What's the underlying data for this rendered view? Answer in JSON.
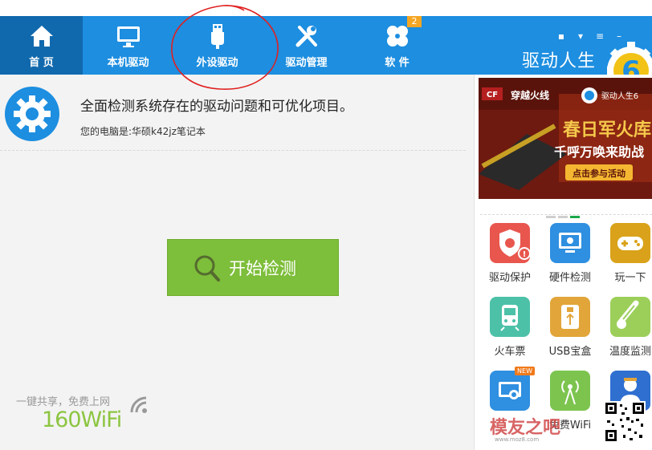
{
  "colors": {
    "nav_bg": "#1d8ee0",
    "nav_active_bg": "#1169ad",
    "start_button": "#7dbe3a",
    "badge": "#f5a623",
    "annotation_circle": "#e02020"
  },
  "nav": {
    "items": [
      {
        "label": "首 页",
        "icon": "home-icon",
        "active": true
      },
      {
        "label": "本机驱动",
        "icon": "monitor-icon"
      },
      {
        "label": "外设驱动",
        "icon": "usb-icon"
      },
      {
        "label": "驱动管理",
        "icon": "tools-icon"
      },
      {
        "label": "软 件",
        "icon": "clover-icon",
        "badge": "2"
      }
    ],
    "brand": "驱动人生",
    "brand_logo_text": "6"
  },
  "main": {
    "title": "全面检测系统存在的驱动问题和可优化项目。",
    "computer": "您的电脑是:华硕k42jz笔记本",
    "start_button": "开始检测"
  },
  "wifi": {
    "slogan": "一键共享，免费上网",
    "logo": "160WiFi"
  },
  "banner": {
    "game": "穿越火线",
    "brand": "驱动人生6",
    "headline": "春日军火库",
    "subline": "千呼万唤来助战",
    "cta": "点击参与活动"
  },
  "tools": [
    {
      "label": "驱动保护",
      "icon": "shield-icon",
      "color": "#e8564d"
    },
    {
      "label": "硬件检测",
      "icon": "monitor-icon",
      "color": "#2f8fe0"
    },
    {
      "label": "玩一下",
      "icon": "gamepad-icon",
      "color": "#d9a21a"
    },
    {
      "label": "火车票",
      "icon": "train-icon",
      "color": "#4cc1a8"
    },
    {
      "label": "USB宝盒",
      "icon": "usb-icon",
      "color": "#e2a53a"
    },
    {
      "label": "温度监测",
      "icon": "thermometer-icon",
      "color": "#9ccf5a"
    },
    {
      "label": "",
      "icon": "screen-icon",
      "color": "#2f8fe0",
      "badge": "NEW"
    },
    {
      "label": "免费WiFi",
      "icon": "wifi-icon",
      "color": "#7cc44e"
    },
    {
      "label": "",
      "icon": "worker-icon",
      "color": "#2f6fd0"
    }
  ],
  "watermark": {
    "text": "模友之吧",
    "url": "www.moz8.com"
  }
}
